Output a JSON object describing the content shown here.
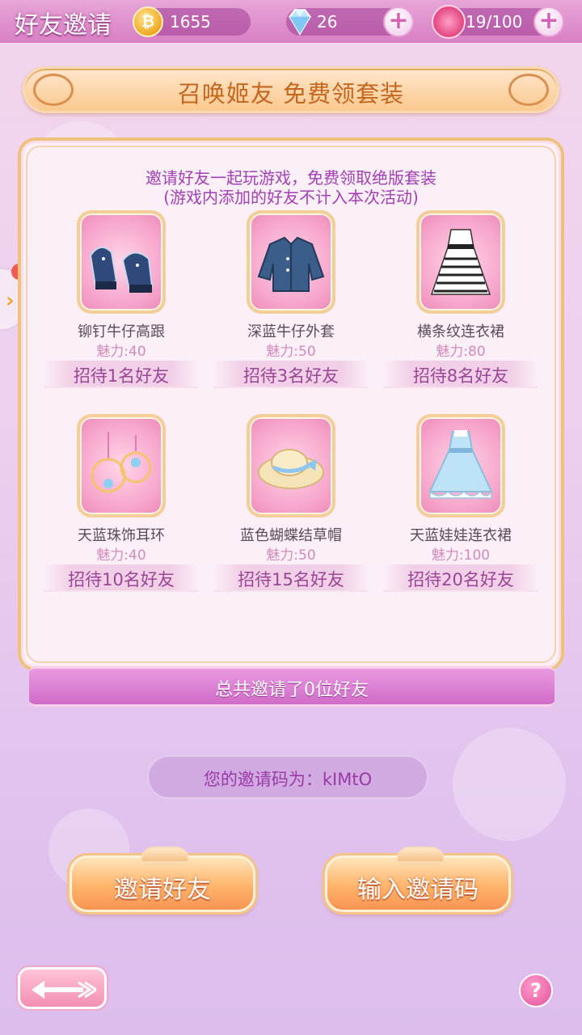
{
  "header": {
    "title": "好友邀请",
    "coins": "1655",
    "diamonds": "26",
    "stamina": "19/100"
  },
  "banner": {
    "title": "召唤姬友 免费领套装"
  },
  "panel": {
    "intro_line1": "邀请好友一起玩游戏，免费领取绝版套装",
    "intro_line2": "(游戏内添加的好友不计入本次活动)",
    "rewards": [
      {
        "name": "铆钉牛仔高跟",
        "charm": "魅力:40",
        "requirement": "招待1名好友",
        "icon": "shoes-icon"
      },
      {
        "name": "深蓝牛仔外套",
        "charm": "魅力:50",
        "requirement": "招待3名好友",
        "icon": "jacket-icon"
      },
      {
        "name": "横条纹连衣裙",
        "charm": "魅力:80",
        "requirement": "招待8名好友",
        "icon": "striped-dress-icon"
      },
      {
        "name": "天蓝珠饰耳环",
        "charm": "魅力:40",
        "requirement": "招待10名好友",
        "icon": "earrings-icon"
      },
      {
        "name": "蓝色蝴蝶结草帽",
        "charm": "魅力:50",
        "requirement": "招待15名好友",
        "icon": "straw-hat-icon"
      },
      {
        "name": "天蓝娃娃连衣裙",
        "charm": "魅力:100",
        "requirement": "招待20名好友",
        "icon": "doll-dress-icon"
      }
    ]
  },
  "total": {
    "text": "总共邀请了0位好友"
  },
  "invite_code": {
    "text": "您的邀请码为：kIMtO"
  },
  "buttons": {
    "invite": "邀请好友",
    "enter_code": "输入邀请码",
    "help": "?"
  },
  "colors": {
    "accent_pink": "#d87fc4",
    "title_purple": "#a23fb3",
    "button_orange": "#f79452"
  }
}
